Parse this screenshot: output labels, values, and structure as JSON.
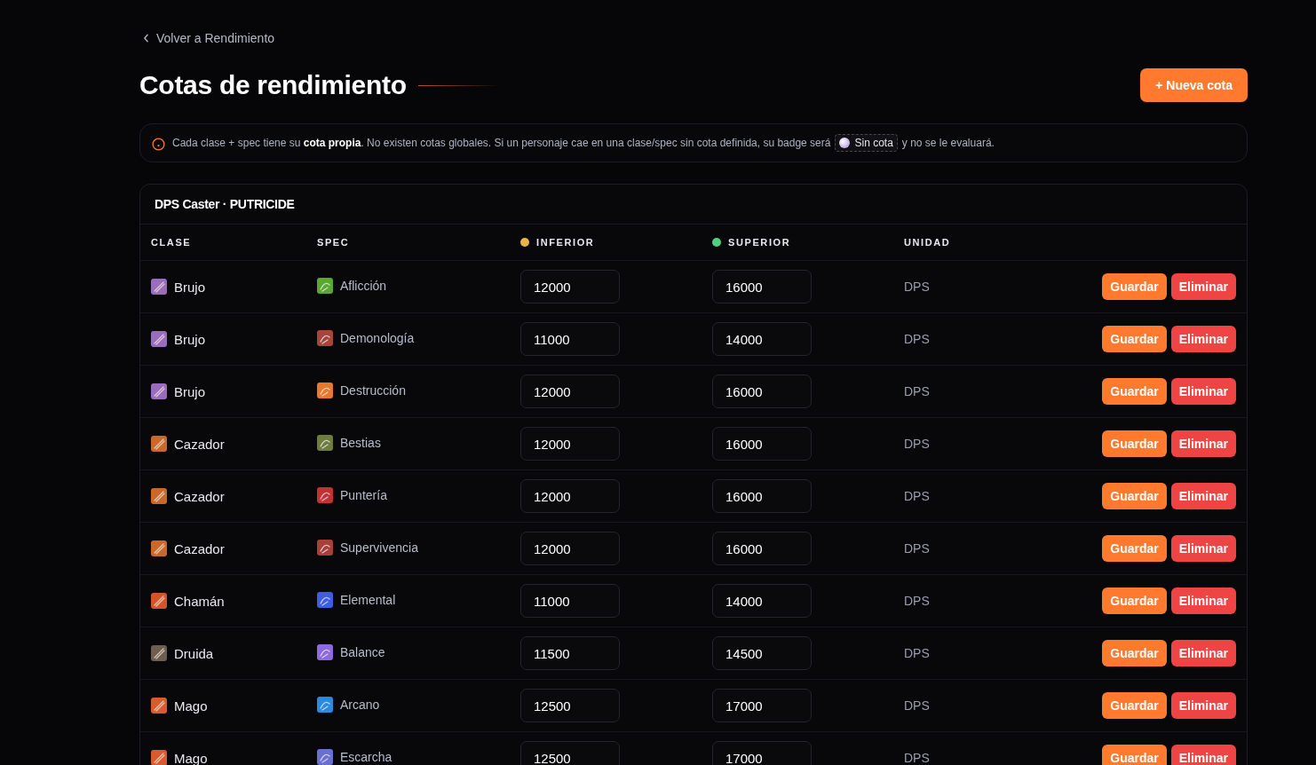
{
  "back_link": {
    "label": "Volver a Rendimiento"
  },
  "title": "Cotas de rendimiento",
  "new_button": {
    "label": "+ Nueva cota"
  },
  "notice": {
    "text_before": "Cada clase + spec tiene su **cota propia**. No existen cotas globales. Si un personaje cae en una clase/spec sin cota definida, su badge será",
    "badge": "Sin cota",
    "text_after": "y no se le evaluará."
  },
  "table": {
    "title": "DPS Caster · PUTRICIDE",
    "columns": [
      {
        "label": "CLASE"
      },
      {
        "label": "SPEC"
      },
      {
        "label": "INFERIOR",
        "color": "#e8b545"
      },
      {
        "label": "SUPERIOR",
        "color": "#4fcf80"
      },
      {
        "label": "UNIDAD"
      }
    ],
    "rows": [
      {
        "class": {
          "name": "Brujo",
          "color": "#9a6cc0"
        },
        "spec": {
          "name": "Aflicción",
          "color": "#5aa830"
        },
        "lower": "12000",
        "upper": "16000",
        "unit": "DPS",
        "actions": [
          {
            "label": "Guardar",
            "kind": "save"
          },
          {
            "label": "Eliminar",
            "kind": "delete"
          }
        ]
      },
      {
        "class": {
          "name": "Brujo",
          "color": "#9a6cc0"
        },
        "spec": {
          "name": "Demonología",
          "color": "#a8453a"
        },
        "lower": "11000",
        "upper": "14000",
        "unit": "DPS",
        "actions": [
          {
            "label": "Guardar",
            "kind": "save"
          },
          {
            "label": "Eliminar",
            "kind": "delete"
          }
        ]
      },
      {
        "class": {
          "name": "Brujo",
          "color": "#9a6cc0"
        },
        "spec": {
          "name": "Destrucción",
          "color": "#e8782a"
        },
        "lower": "12000",
        "upper": "16000",
        "unit": "DPS",
        "actions": [
          {
            "label": "Guardar",
            "kind": "save"
          },
          {
            "label": "Eliminar",
            "kind": "delete"
          }
        ]
      },
      {
        "class": {
          "name": "Cazador",
          "color": "#c8682a"
        },
        "spec": {
          "name": "Bestias",
          "color": "#6f7d3c"
        },
        "lower": "12000",
        "upper": "16000",
        "unit": "DPS",
        "actions": [
          {
            "label": "Guardar",
            "kind": "save"
          },
          {
            "label": "Eliminar",
            "kind": "delete"
          }
        ]
      },
      {
        "class": {
          "name": "Cazador",
          "color": "#c8682a"
        },
        "spec": {
          "name": "Puntería",
          "color": "#c23232"
        },
        "lower": "12000",
        "upper": "16000",
        "unit": "DPS",
        "actions": [
          {
            "label": "Guardar",
            "kind": "save"
          },
          {
            "label": "Eliminar",
            "kind": "delete"
          }
        ]
      },
      {
        "class": {
          "name": "Cazador",
          "color": "#c8682a"
        },
        "spec": {
          "name": "Supervivencia",
          "color": "#a84038"
        },
        "lower": "12000",
        "upper": "16000",
        "unit": "DPS",
        "actions": [
          {
            "label": "Guardar",
            "kind": "save"
          },
          {
            "label": "Eliminar",
            "kind": "delete"
          }
        ]
      },
      {
        "class": {
          "name": "Chamán",
          "color": "#d2552a"
        },
        "spec": {
          "name": "Elemental",
          "color": "#3d5ee0"
        },
        "lower": "11000",
        "upper": "14000",
        "unit": "DPS",
        "actions": [
          {
            "label": "Guardar",
            "kind": "save"
          },
          {
            "label": "Eliminar",
            "kind": "delete"
          }
        ]
      },
      {
        "class": {
          "name": "Druida",
          "color": "#6e5e52"
        },
        "spec": {
          "name": "Balance",
          "color": "#8c6ae0"
        },
        "lower": "11500",
        "upper": "14500",
        "unit": "DPS",
        "actions": [
          {
            "label": "Guardar",
            "kind": "save"
          },
          {
            "label": "Eliminar",
            "kind": "delete"
          }
        ]
      },
      {
        "class": {
          "name": "Mago",
          "color": "#d85a30"
        },
        "spec": {
          "name": "Arcano",
          "color": "#2a8ae0"
        },
        "lower": "12500",
        "upper": "17000",
        "unit": "DPS",
        "actions": [
          {
            "label": "Guardar",
            "kind": "save"
          },
          {
            "label": "Eliminar",
            "kind": "delete"
          }
        ]
      },
      {
        "class": {
          "name": "Mago",
          "color": "#d85a30"
        },
        "spec": {
          "name": "Escarcha",
          "color": "#6a70d0"
        },
        "lower": "12500",
        "upper": "17000",
        "unit": "DPS",
        "actions": [
          {
            "label": "Guardar",
            "kind": "save"
          },
          {
            "label": "Eliminar",
            "kind": "delete"
          }
        ]
      }
    ]
  }
}
